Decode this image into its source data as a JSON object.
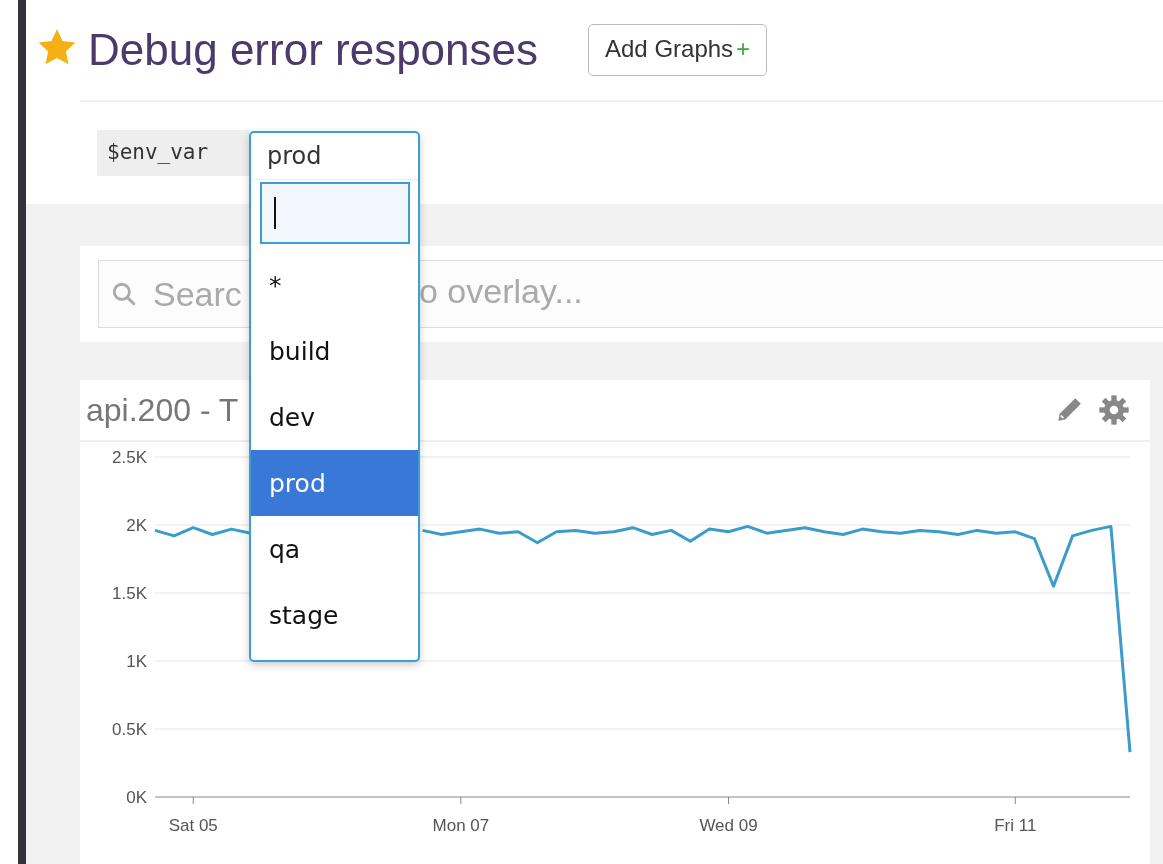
{
  "dashboard": {
    "title": "Debug error responses",
    "starred": true,
    "add_button": "Add Graphs",
    "add_icon": "+"
  },
  "template_variable": {
    "name": "$env_var",
    "value": "prod",
    "open": true,
    "options": [
      {
        "label": "*",
        "selected": false
      },
      {
        "label": "build",
        "selected": false
      },
      {
        "label": "dev",
        "selected": false
      },
      {
        "label": "prod",
        "selected": true
      },
      {
        "label": "qa",
        "selected": false
      },
      {
        "label": "stage",
        "selected": false
      }
    ]
  },
  "search": {
    "placeholder_parts": [
      "Searc",
      "o overlay..."
    ]
  },
  "graph": {
    "title": "api.200 - T",
    "chart_data": {
      "type": "line",
      "categories": [
        null,
        null,
        "Sat 05",
        null,
        null,
        null,
        null,
        null,
        null,
        null,
        null,
        null,
        null,
        null,
        null,
        null,
        "Mon 07",
        null,
        null,
        null,
        null,
        null,
        null,
        null,
        null,
        null,
        null,
        null,
        null,
        null,
        "Wed 09",
        null,
        null,
        null,
        null,
        null,
        null,
        null,
        null,
        null,
        null,
        null,
        null,
        null,
        null,
        "Fri 11",
        null,
        null,
        null,
        null,
        null,
        null
      ],
      "series": [
        {
          "color": "#3b9cc9",
          "values": [
            1960,
            1920,
            1980,
            1930,
            1970,
            1940,
            null,
            null,
            null,
            null,
            null,
            null,
            null,
            null,
            1960,
            1930,
            1950,
            1970,
            1940,
            1950,
            1870,
            1950,
            1960,
            1940,
            1950,
            1980,
            1930,
            1960,
            1880,
            1970,
            1950,
            1990,
            1940,
            1960,
            1980,
            1950,
            1930,
            1970,
            1950,
            1940,
            1960,
            1950,
            1930,
            1960,
            1940,
            1950,
            1900,
            1550,
            1920,
            1960,
            1990,
            330
          ]
        }
      ],
      "ylim": [
        0,
        2500
      ],
      "grid": true,
      "yticks": [
        {
          "value": 0,
          "label": "0K"
        },
        {
          "value": 500,
          "label": "0.5K"
        },
        {
          "value": 1000,
          "label": "1K"
        },
        {
          "value": 1500,
          "label": "1.5K"
        },
        {
          "value": 2000,
          "label": "2K"
        },
        {
          "value": 2500,
          "label": "2.5K"
        }
      ]
    }
  }
}
